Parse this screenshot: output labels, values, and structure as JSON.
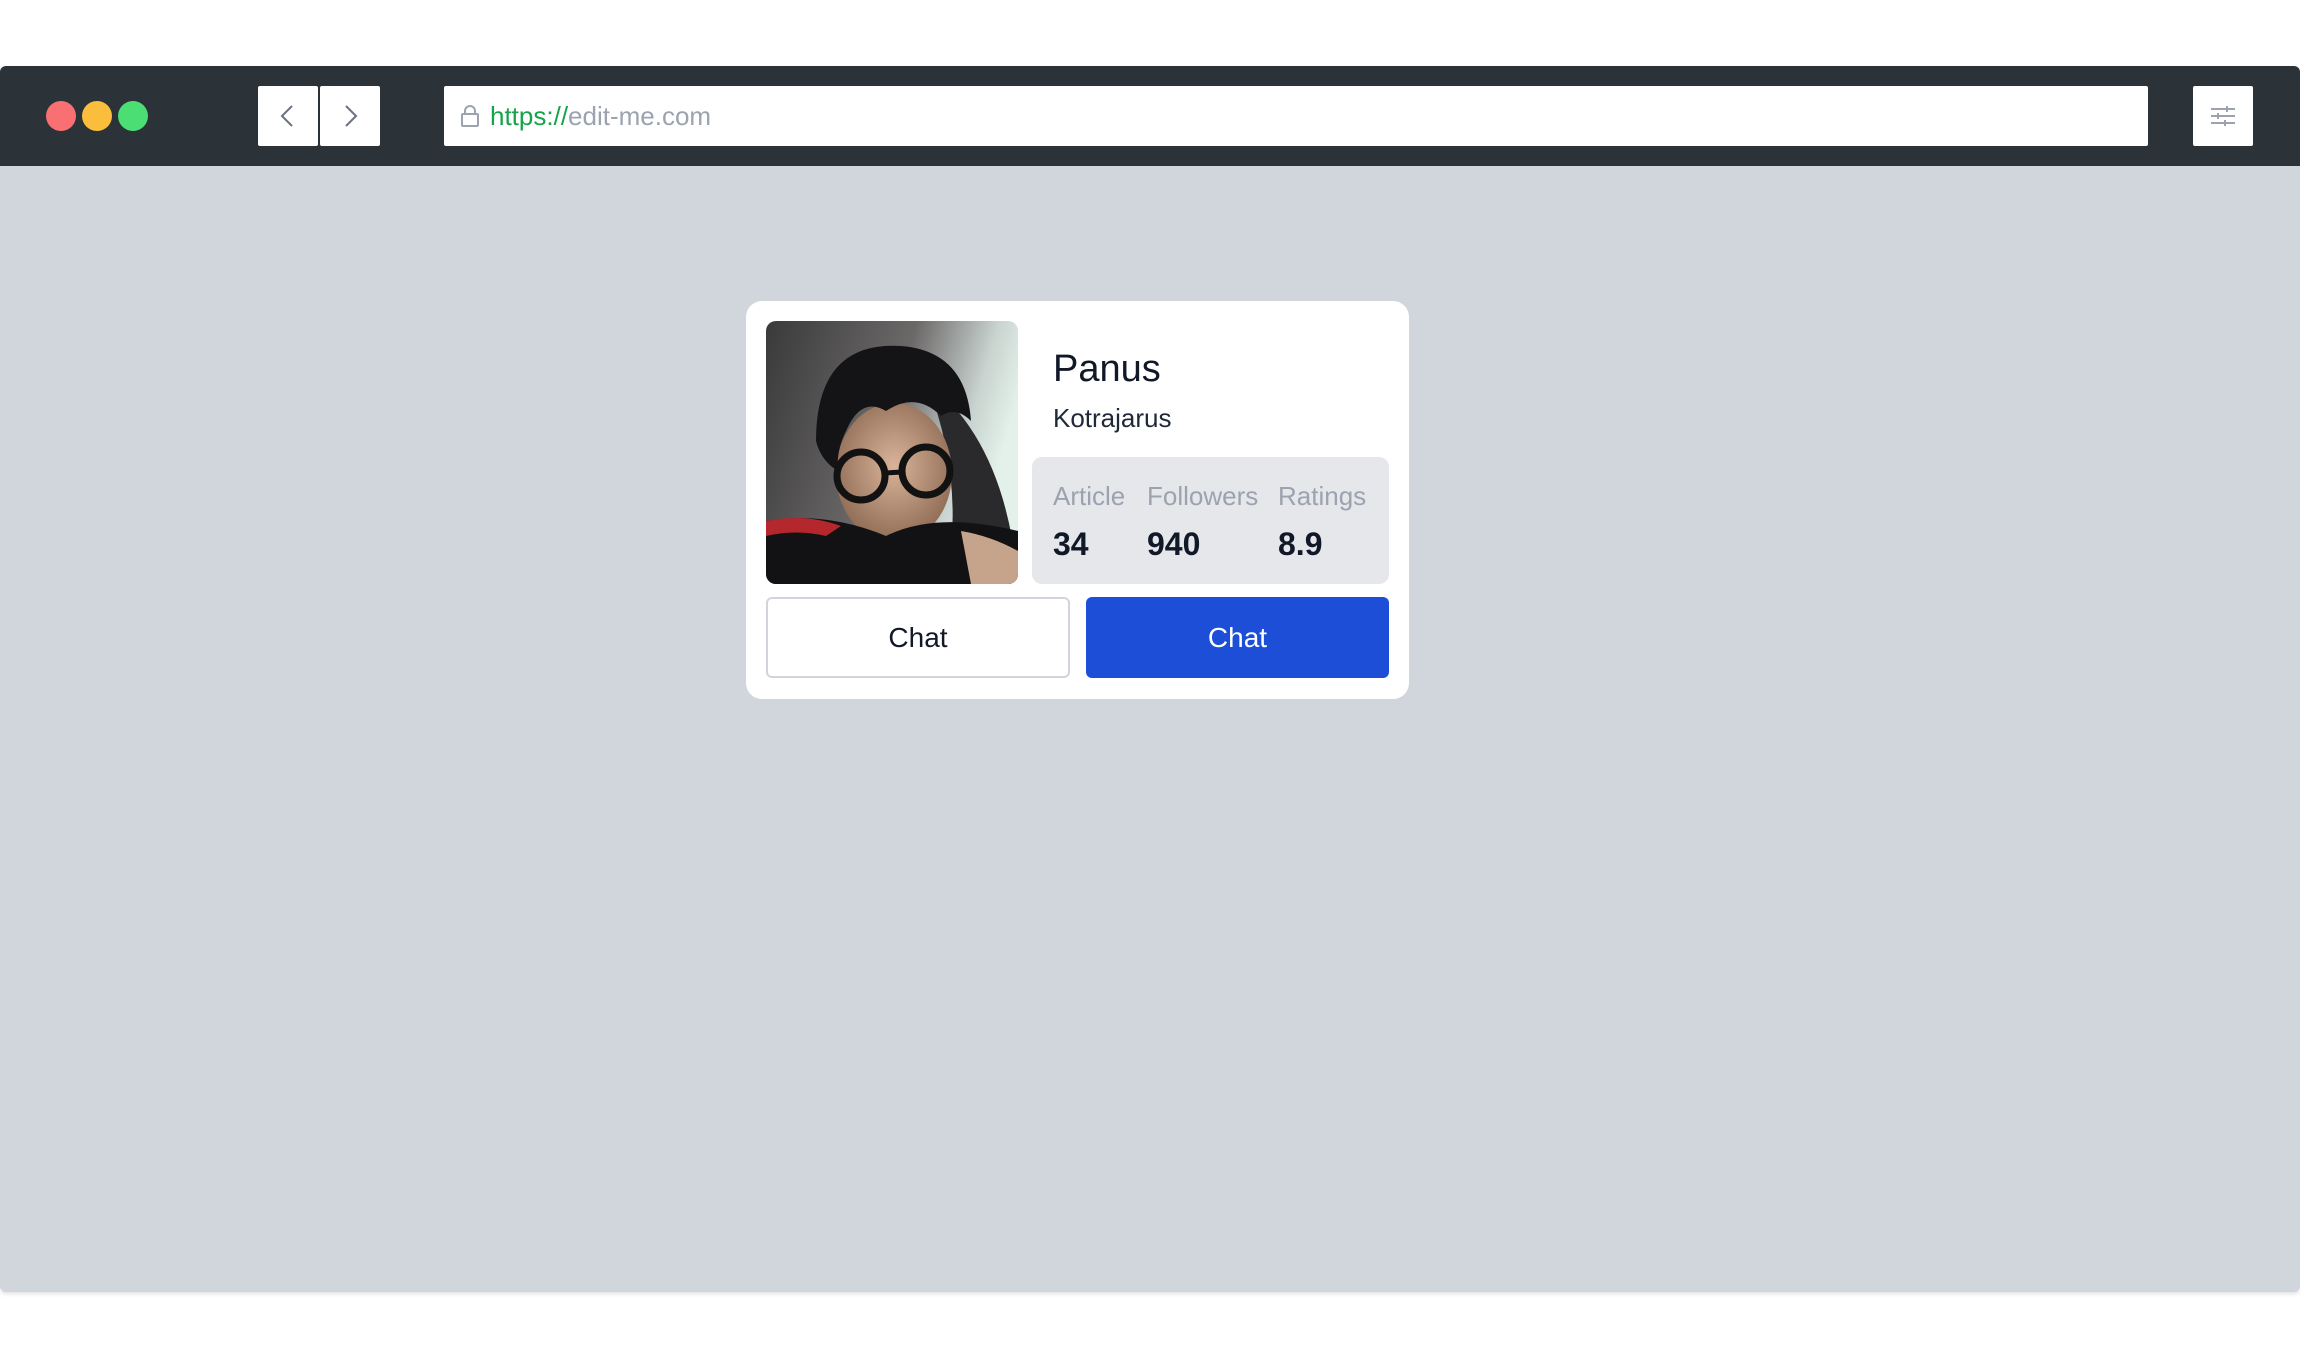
{
  "browser": {
    "url_protocol": "https://",
    "url_host": "edit-me.com",
    "icons": {
      "back": "chevron-left-icon",
      "forward": "chevron-right-icon",
      "lock": "lock-icon",
      "menu": "sliders-icon"
    }
  },
  "profile": {
    "first_name": "Panus",
    "last_name": "Kotrajarus",
    "stats": [
      {
        "label": "Article",
        "value": "34"
      },
      {
        "label": "Followers",
        "value": "940"
      },
      {
        "label": "Ratings",
        "value": "8.9"
      }
    ],
    "buttons": {
      "secondary_label": "Chat",
      "primary_label": "Chat"
    }
  },
  "colors": {
    "toolbar": "#2b3238",
    "page_background": "#d1d5dc",
    "primary_button": "#1d4ed8",
    "url_protocol": "#16a34a"
  }
}
